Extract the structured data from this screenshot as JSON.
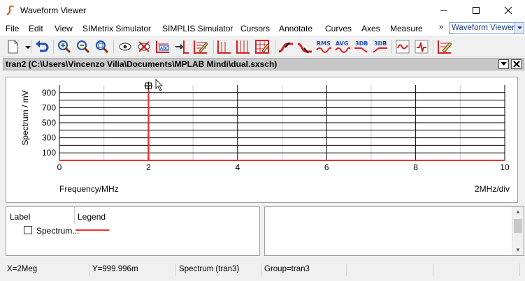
{
  "window": {
    "title": "Waveform Viewer",
    "controls": [
      "minimize",
      "maximize",
      "close"
    ]
  },
  "menubar": {
    "items": [
      "File",
      "Edit",
      "View",
      "SIMetrix Simulator",
      "SIMPLIS Simulator",
      "Cursors",
      "Annotate",
      "Curves",
      "Axes",
      "Measure"
    ],
    "overflow": "»",
    "combo_value": "Waveform Viewer"
  },
  "toolbar": {
    "icons": [
      "new-document-icon",
      "dropdown-arrow-icon",
      "undo-icon",
      "zoom-in-icon",
      "zoom-out-icon",
      "zoom-fit-icon",
      "show-curve-icon",
      "hide-curve-icon",
      "curve-label-icon",
      "export-curve-icon",
      "edit-curve-icon",
      "axis-grid-icon",
      "vertical-grid-icon",
      "grid-toggle-icon",
      "rising-edge-icon",
      "falling-edge-icon",
      "rms-icon",
      "avg-icon",
      "3db-low-icon",
      "3db-high-icon",
      "waveform-icon",
      "spike-icon",
      "edit-properties-icon"
    ],
    "rms_label": "RMS",
    "avg_label": "AVG",
    "db3_low_label": "3DB",
    "db3_high_label": "3DB"
  },
  "tab": {
    "title": "tran2 (C:\\Users\\Vincenzo Villa\\Documents\\MPLAB Mindi\\dual.sxsch)"
  },
  "chart_data": {
    "type": "line",
    "ylabel": "Spectrum / mV",
    "xlabel": "Frequency/MHz",
    "x_div_label": "2MHz/div",
    "xlim": [
      0,
      10
    ],
    "ylim": [
      0,
      1000
    ],
    "x_ticks": [
      0,
      2,
      4,
      6,
      8,
      10
    ],
    "y_ticks": [
      100,
      300,
      500,
      700,
      900
    ],
    "grid": true,
    "series": [
      {
        "name": "Spectrum (tran3)",
        "color": "#e8322c",
        "x": [
          0,
          1.995,
          2.0,
          2.005,
          10
        ],
        "y": [
          0,
          0,
          999.996,
          0,
          0
        ]
      }
    ],
    "cursor": {
      "x": 2,
      "y": 999.996
    }
  },
  "legend_panel": {
    "label_header": "Label",
    "legend_header": "Legend",
    "rows": [
      {
        "label": "Spectrum...",
        "color": "#e8322c"
      }
    ]
  },
  "statusbar": {
    "x": "X=2Meg",
    "y": "Y=999.996m",
    "curve": "Spectrum (tran3)",
    "group": "Group=tran3"
  }
}
